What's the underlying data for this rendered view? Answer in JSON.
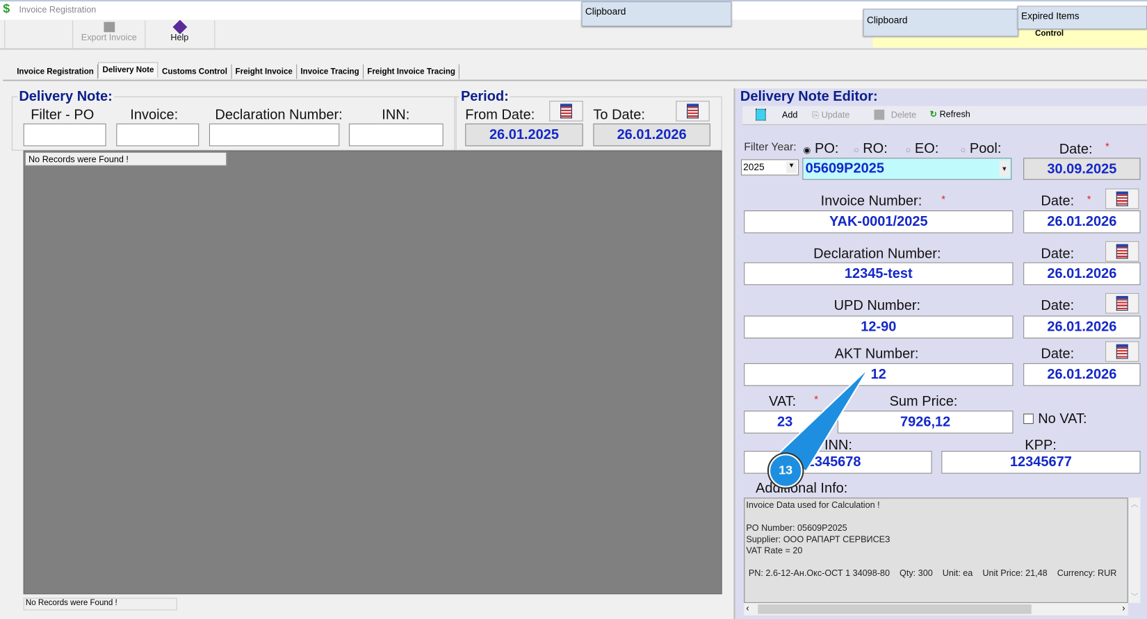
{
  "window": {
    "title": "Invoice Registration",
    "icon": "dollar-icon"
  },
  "toolbar": {
    "export_label": "Export Invoice",
    "help_label": "Help"
  },
  "popups": {
    "clipboard1": "Clipboard",
    "clipboard2": "Clipboard",
    "expired": "Expired Items",
    "behind_text": "Control"
  },
  "tabs": [
    "Invoice Registration",
    "Delivery Note",
    "Customs Control",
    "Freight Invoice",
    "Invoice Tracing",
    "Freight Invoice Tracing"
  ],
  "active_tab": "Delivery Note",
  "delivery_note": {
    "title": "Delivery Note:",
    "filter_po_label": "Filter - PO",
    "invoice_label": "Invoice:",
    "declaration_label": "Declaration Number:",
    "inn_label": "INN:",
    "filter_po": "",
    "invoice": "",
    "declaration": "",
    "inn": "",
    "no_records": "No Records were Found !",
    "status": "No Records were Found !"
  },
  "period": {
    "title": "Period:",
    "from_label": "From Date:",
    "to_label": "To Date:",
    "from_date": "26.01.2025",
    "to_date": "26.01.2026"
  },
  "editor": {
    "title": "Delivery Note Editor:",
    "add": "Add",
    "update": "Update",
    "delete": "Delete",
    "refresh": "Refresh",
    "filter_year_label": "Filter Year:",
    "filter_year": "2025",
    "radio_po": "PO:",
    "radio_ro": "RO:",
    "radio_eo": "EO:",
    "radio_pool": "Pool:",
    "selected_radio": "PO",
    "order": "05609P2025",
    "date_label": "Date:",
    "order_date": "30.09.2025",
    "invoice_number_label": "Invoice Number:",
    "invoice_number": "YAK-0001/2025",
    "invoice_date": "26.01.2026",
    "declaration_label": "Declaration Number:",
    "declaration": "12345-test",
    "declaration_date": "26.01.2026",
    "upd_label": "UPD Number:",
    "upd": "12-90",
    "upd_date": "26.01.2026",
    "akt_label": "AKT Number:",
    "akt": "12",
    "akt_date": "26.01.2026",
    "vat_label": "VAT:",
    "vat": "23",
    "sum_label": "Sum Price:",
    "sum": "7926,12",
    "no_vat_label": "No VAT:",
    "no_vat": false,
    "inn_label": "INN:",
    "inn": "12345678",
    "kpp_label": "KPP:",
    "kpp": "12345677",
    "additional_label": "Additional Info:",
    "additional_info": "Invoice Data used for Calculation !\n\nPO Number: 05609P2025\nSupplier: ООО РАПАРТ СЕРВИСЕЗ\nVAT Rate = 20\n\n PN: 2.6-12-Ан.Окс-ОСТ 1 34098-80    Qty: 300    Unit: ea    Unit Price: 21,48    Currency: RUR"
  },
  "callout": {
    "number": "13",
    "color": "#1e8fe0"
  }
}
